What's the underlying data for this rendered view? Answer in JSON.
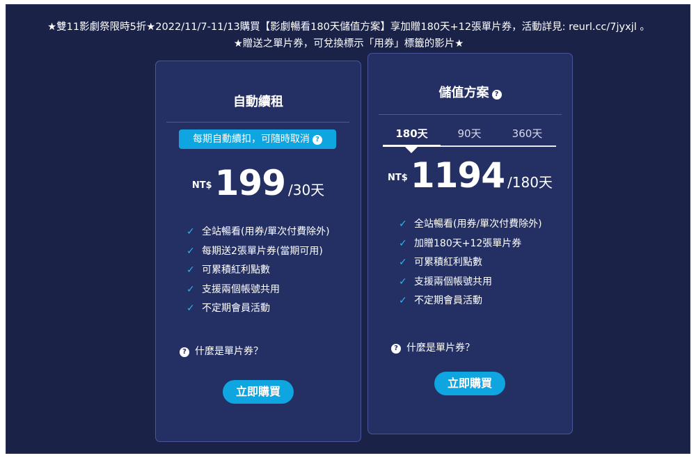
{
  "banner": {
    "line1": "★雙11影劇祭限時5折★2022/11/7-11/13購買【影劇暢看180天儲值方案】享加贈180天+12張單片券，活動詳見: reurl.cc/7jyxjl 。",
    "line2": "★贈送之單片券，可兌換標示「用券」標籤的影片★"
  },
  "plans": {
    "subscription": {
      "title": "自動續租",
      "note": "每期自動續扣，可隨時取消",
      "currency": "NT$",
      "price": "199",
      "period": "/30天",
      "features": [
        "全站暢看(用券/單次付費除外)",
        "每期送2張單片券(當期可用)",
        "可累積紅利點數",
        "支援兩個帳號共用",
        "不定期會員活動"
      ],
      "question": "什麼是單片券？",
      "buy_label": "立即購買"
    },
    "prepaid": {
      "title": "儲值方案",
      "tabs": [
        "180天",
        "90天",
        "360天"
      ],
      "active_tab": "180天",
      "currency": "NT$",
      "price": "1194",
      "period": "/180天",
      "features": [
        "全站暢看(用券/單次付費除外)",
        "加贈180天+12張單片券",
        "可累積紅利點數",
        "支援兩個帳號共用",
        "不定期會員活動"
      ],
      "question": "什麼是單片券？",
      "buy_label": "立即購買"
    }
  },
  "icons": {
    "check": "check-icon",
    "help": "question-circle-icon"
  },
  "colors": {
    "background": "#1a2247",
    "card": "#243063",
    "accent": "#0ea5e0",
    "check": "#29b6f0"
  }
}
